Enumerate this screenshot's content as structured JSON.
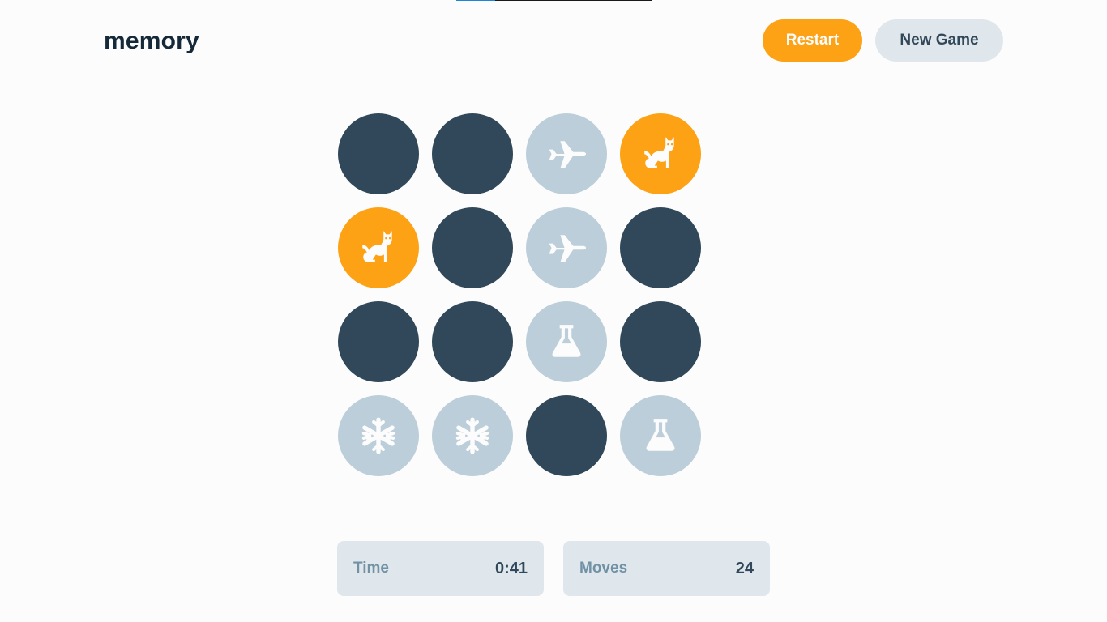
{
  "app": {
    "logo": "memory",
    "load_progress": 0.2
  },
  "header": {
    "restart_label": "Restart",
    "new_game_label": "New Game"
  },
  "board": {
    "columns": 4,
    "rows": 4,
    "tiles": [
      {
        "state": "hidden",
        "icon": null
      },
      {
        "state": "hidden",
        "icon": null
      },
      {
        "state": "matched",
        "icon": "plane-icon"
      },
      {
        "state": "active",
        "icon": "cat-icon"
      },
      {
        "state": "active",
        "icon": "cat-icon"
      },
      {
        "state": "hidden",
        "icon": null
      },
      {
        "state": "matched",
        "icon": "plane-icon"
      },
      {
        "state": "hidden",
        "icon": null
      },
      {
        "state": "hidden",
        "icon": null
      },
      {
        "state": "hidden",
        "icon": null
      },
      {
        "state": "matched",
        "icon": "flask-icon"
      },
      {
        "state": "hidden",
        "icon": null
      },
      {
        "state": "matched",
        "icon": "snowflake-icon"
      },
      {
        "state": "matched",
        "icon": "snowflake-icon"
      },
      {
        "state": "hidden",
        "icon": null
      },
      {
        "state": "matched",
        "icon": "flask-icon"
      }
    ]
  },
  "stats": {
    "time_label": "Time",
    "time_value": "0:41",
    "moves_label": "Moves",
    "moves_value": "24"
  },
  "colors": {
    "hidden": "#304859",
    "matched": "#bcced9",
    "active": "#fda214",
    "background": "#fcfcfc",
    "text_dark": "#152938",
    "icon": "#fcfcfc"
  }
}
